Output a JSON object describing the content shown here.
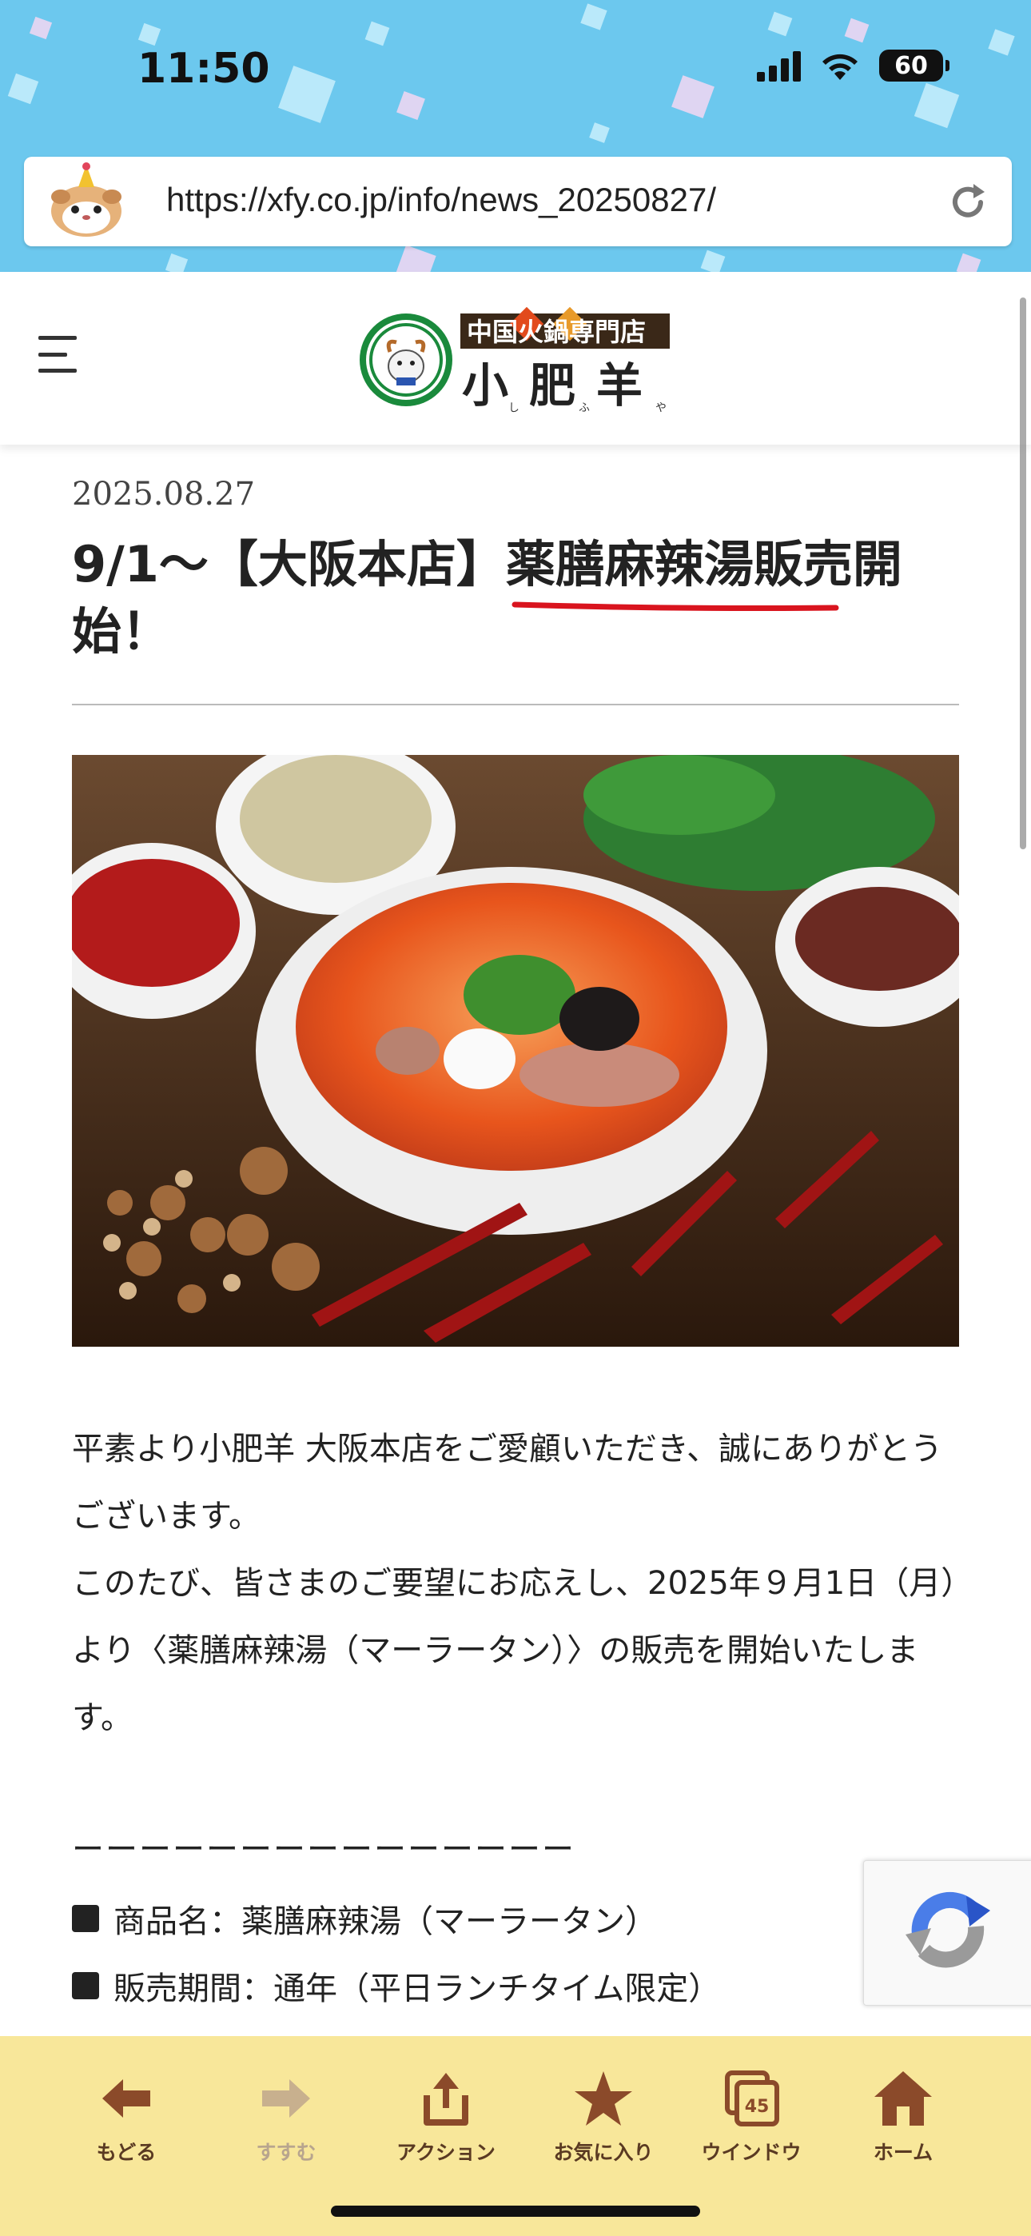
{
  "status_bar": {
    "time": "11:50",
    "battery": "60"
  },
  "browser": {
    "url": "https://xfy.co.jp/info/news_20250827/"
  },
  "site": {
    "logo_top_text": "中国火鍋専門店",
    "logo_name": "小肥羊",
    "logo_ruby": [
      "しゃお",
      "ふぇい",
      "やん"
    ]
  },
  "article": {
    "date": "2025.08.27",
    "title": "9/1〜【大阪本店】薬膳麻辣湯販売開始！",
    "paragraphs": [
      "平素より小肥羊 大阪本店をご愛顧いただき、誠にありがとうございます。",
      "このたび、皆さまのご要望にお応えし、2025年９月1日（月）より〈薬膳麻辣湯（マーラータン）〉の販売を開始いたします。"
    ],
    "separator": "ーーーーーーーーーーーーーーー",
    "specs": [
      "商品名：薬膳麻辣湯（マーラータン）",
      "販売期間：通年（平日ランチタイム限定）"
    ]
  },
  "toolbar": {
    "items": [
      {
        "label": "もどる",
        "icon": "arrow-left-icon"
      },
      {
        "label": "すすむ",
        "icon": "arrow-right-icon"
      },
      {
        "label": "アクション",
        "icon": "share-icon"
      },
      {
        "label": "お気に入り",
        "icon": "star-icon"
      },
      {
        "label": "ウインドウ",
        "icon": "windows-icon",
        "badge": "45"
      },
      {
        "label": "ホーム",
        "icon": "home-icon"
      }
    ]
  },
  "colors": {
    "sky": "#6cc8ee",
    "toolbar": "#f8e79a",
    "toolbar_icon": "#8b4a2a",
    "underline": "#d9141e"
  }
}
